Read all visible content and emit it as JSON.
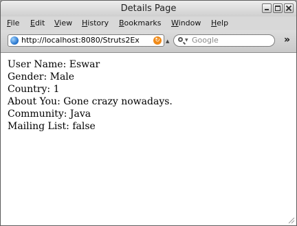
{
  "window": {
    "title": "Details Page"
  },
  "menu": [
    "File",
    "Edit",
    "View",
    "History",
    "Bookmarks",
    "Window",
    "Help"
  ],
  "toolbar": {
    "url": "http://localhost:8080/Struts2Ex",
    "search_placeholder": "Google"
  },
  "details": [
    {
      "label": "User Name",
      "value": "Eswar"
    },
    {
      "label": "Gender",
      "value": "Male"
    },
    {
      "label": "Country",
      "value": "1"
    },
    {
      "label": "About You",
      "value": "Gone crazy nowadays."
    },
    {
      "label": "Community",
      "value": "Java"
    },
    {
      "label": "Mailing List",
      "value": "false"
    }
  ],
  "icons": {
    "site": "globe-icon",
    "feed": "feed-icon",
    "search": "magnifier-icon",
    "overflow": "chevron-double-right-icon"
  }
}
